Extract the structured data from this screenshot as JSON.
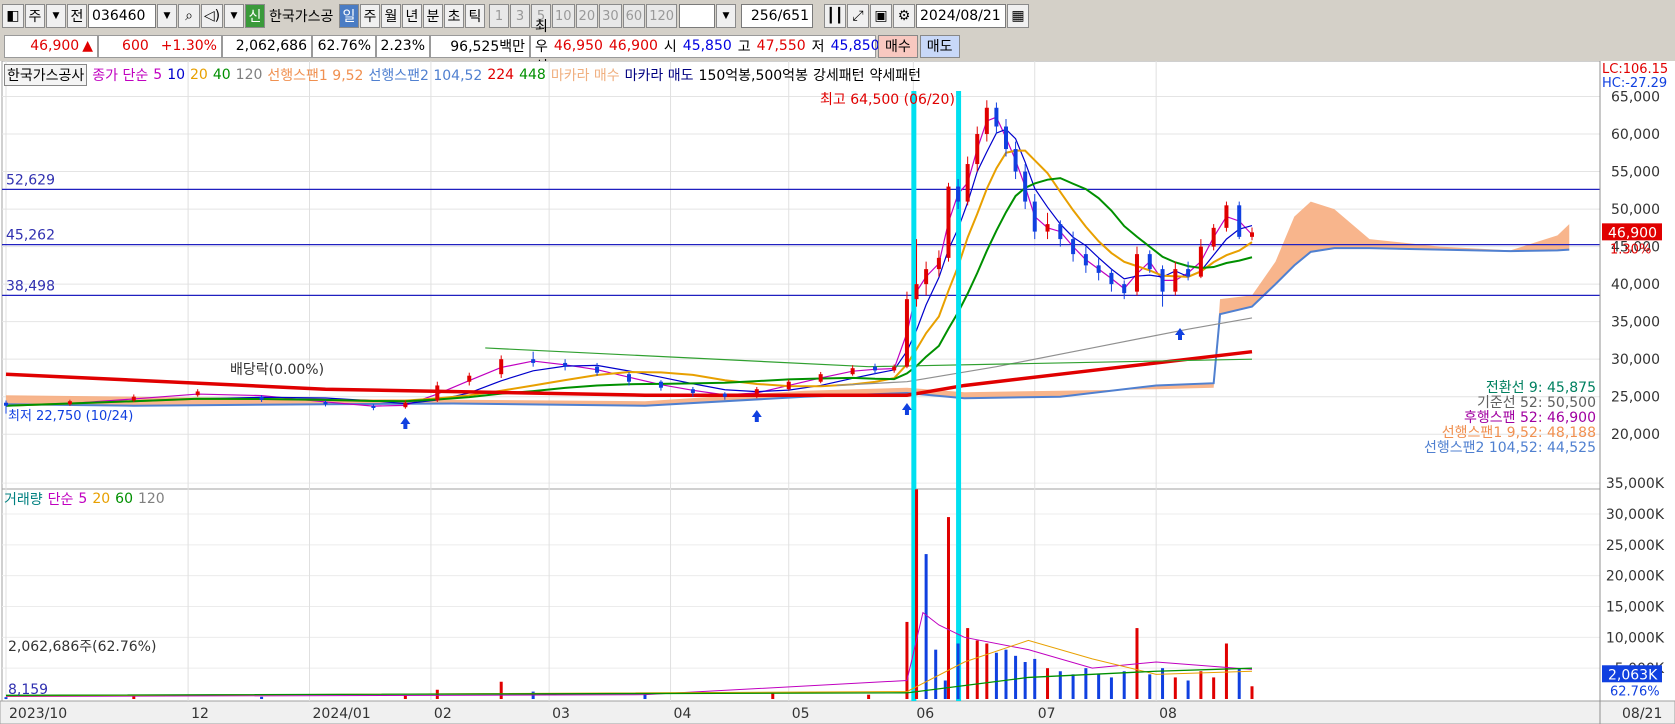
{
  "toolbar": {
    "period_btn": "주",
    "prev_btn": "전",
    "code": "036460",
    "new_btn": "신",
    "stock_name": "한국가스공",
    "period_tabs": [
      "일",
      "주",
      "월",
      "년",
      "분",
      "초",
      "틱"
    ],
    "active_tab": "일",
    "intervals": [
      "1",
      "3",
      "5",
      "10",
      "20",
      "30",
      "60",
      "120"
    ],
    "count": "256",
    "total": "/651",
    "date": "2024/08/21"
  },
  "quote": {
    "price": "46,900",
    "arrow": "▲",
    "change": "600",
    "change_pct": "+1.30%",
    "volume": "2,062,686",
    "vol_ratio": "62.76%",
    "turnover": "2.23%",
    "amount": "96,525백만",
    "best_label": "최우선",
    "ask": "46,950",
    "bid": "46,900",
    "open_label": "시",
    "open": "45,850",
    "high_label": "고",
    "high": "47,550",
    "low_label": "저",
    "low": "45,850",
    "buy_btn": "매수",
    "sell_btn": "매도"
  },
  "price_legend": [
    {
      "text": "한국가스공사",
      "color": "#000000",
      "boxed": true
    },
    {
      "text": "종가 단순",
      "color": "#c000c0"
    },
    {
      "text": "5",
      "color": "#c000c0"
    },
    {
      "text": "10",
      "color": "#0000cc"
    },
    {
      "text": "20",
      "color": "#e8a000"
    },
    {
      "text": "40",
      "color": "#009000"
    },
    {
      "text": "120",
      "color": "#808080"
    },
    {
      "text": "선행스팬1 9,52",
      "color": "#f09050"
    },
    {
      "text": "선행스팬2 104,52",
      "color": "#5080d0"
    },
    {
      "text": "224",
      "color": "#e00000"
    },
    {
      "text": "448",
      "color": "#009000"
    },
    {
      "text": "마카라 매수",
      "color": "#f0b080"
    },
    {
      "text": "마카라 매도",
      "color": "#000080"
    },
    {
      "text": "150억봉,500억봉",
      "color": "#000000"
    },
    {
      "text": "강세패턴",
      "color": "#000000"
    },
    {
      "text": "약세패턴",
      "color": "#000000"
    }
  ],
  "volume_legend": [
    {
      "text": "거래량",
      "color": "#008080"
    },
    {
      "text": "단순",
      "color": "#c000c0"
    },
    {
      "text": "5",
      "color": "#c000c0"
    },
    {
      "text": "20",
      "color": "#e8a000"
    },
    {
      "text": "60",
      "color": "#009000"
    },
    {
      "text": "120",
      "color": "#808080"
    }
  ],
  "volume_info": "2,062,686주(62.76%)",
  "colors": {
    "up": "#e00000",
    "down": "#1040e0",
    "cyan": "#00e0f0",
    "hline": "#2020c0"
  },
  "chart_data": {
    "type": "candlestick",
    "x_ticks": [
      "2023/10",
      "12",
      "2024/01",
      "02",
      "03",
      "04",
      "05",
      "06",
      "07",
      "08"
    ],
    "last_date_label": "08/21",
    "y_ticks": [
      "65,000",
      "60,000",
      "55,000",
      "50,000",
      "45,000",
      "40,000",
      "35,000",
      "30,000",
      "25,000",
      "20,000"
    ],
    "ylim": [
      17500,
      66000
    ],
    "h_lines": [
      {
        "value": 52629,
        "label": "52,629"
      },
      {
        "value": 45262,
        "label": "45,262"
      },
      {
        "value": 38498,
        "label": "38,498"
      }
    ],
    "current_price": "46,900",
    "current_pct": "1.30%",
    "lc": "LC:106.15",
    "hc": "HC:-27.29",
    "high_annot": "최고 64,500 (06/20)",
    "low_annot": "최저 22,750 (10/24)",
    "dividend_annot": "배당락(0.00%)",
    "ichimoku": [
      {
        "text": "전환선 9: 45,875",
        "color": "#008060"
      },
      {
        "text": "기준선 52: 50,500",
        "color": "#606060"
      },
      {
        "text": "후행스팬 52: 46,900",
        "color": "#a000a0"
      },
      {
        "text": "선행스팬1 9,52: 48,188",
        "color": "#f09050"
      },
      {
        "text": "선행스팬2 104,52: 44,525",
        "color": "#5080d0"
      }
    ],
    "price_series": [
      {
        "d": 0,
        "o": 24200,
        "c": 23800,
        "h": 24500,
        "l": 22750
      },
      {
        "d": 20,
        "o": 24000,
        "c": 24400,
        "h": 24600,
        "l": 23800
      },
      {
        "d": 40,
        "o": 24500,
        "c": 25000,
        "h": 25300,
        "l": 24300
      },
      {
        "d": 60,
        "o": 25200,
        "c": 25700,
        "h": 26000,
        "l": 25000
      },
      {
        "d": 80,
        "o": 25000,
        "c": 24600,
        "h": 25200,
        "l": 24300
      },
      {
        "d": 100,
        "o": 24300,
        "c": 24000,
        "h": 24500,
        "l": 23700
      },
      {
        "d": 115,
        "o": 23800,
        "c": 23500,
        "h": 24000,
        "l": 23200
      },
      {
        "d": 125,
        "o": 23600,
        "c": 24200,
        "h": 24500,
        "l": 23400
      },
      {
        "d": 135,
        "o": 24500,
        "c": 26500,
        "h": 27000,
        "l": 24300
      },
      {
        "d": 145,
        "o": 27000,
        "c": 27800,
        "h": 28200,
        "l": 26500
      },
      {
        "d": 155,
        "o": 28000,
        "c": 30000,
        "h": 30500,
        "l": 27500
      },
      {
        "d": 165,
        "o": 30000,
        "c": 29500,
        "h": 31000,
        "l": 29000
      },
      {
        "d": 175,
        "o": 29500,
        "c": 29000,
        "h": 30000,
        "l": 28500
      },
      {
        "d": 185,
        "o": 29000,
        "c": 28200,
        "h": 29500,
        "l": 27800
      },
      {
        "d": 195,
        "o": 28000,
        "c": 27000,
        "h": 28300,
        "l": 26500
      },
      {
        "d": 205,
        "o": 27000,
        "c": 26200,
        "h": 27200,
        "l": 25800
      },
      {
        "d": 215,
        "o": 26000,
        "c": 25500,
        "h": 26300,
        "l": 25000
      },
      {
        "d": 225,
        "o": 25400,
        "c": 25000,
        "h": 25600,
        "l": 24600
      },
      {
        "d": 235,
        "o": 25000,
        "c": 26000,
        "h": 26300,
        "l": 24800
      },
      {
        "d": 245,
        "o": 26000,
        "c": 27000,
        "h": 27300,
        "l": 25800
      },
      {
        "d": 255,
        "o": 27000,
        "c": 28000,
        "h": 28300,
        "l": 26800
      },
      {
        "d": 265,
        "o": 28000,
        "c": 28800,
        "h": 29200,
        "l": 27800
      },
      {
        "d": 272,
        "o": 29000,
        "c": 28500,
        "h": 29400,
        "l": 28000
      },
      {
        "d": 278,
        "o": 28500,
        "c": 29000,
        "h": 29300,
        "l": 28200
      },
      {
        "d": 282,
        "o": 29000,
        "c": 38000,
        "h": 39000,
        "l": 28800
      },
      {
        "d": 285,
        "o": 38000,
        "c": 40000,
        "h": 46000,
        "l": 37000
      },
      {
        "d": 288,
        "o": 40000,
        "c": 42000,
        "h": 43000,
        "l": 38500
      },
      {
        "d": 292,
        "o": 42000,
        "c": 43500,
        "h": 44500,
        "l": 41000
      },
      {
        "d": 295,
        "o": 43500,
        "c": 53000,
        "h": 53500,
        "l": 43000
      },
      {
        "d": 298,
        "o": 53000,
        "c": 51000,
        "h": 54000,
        "l": 50000
      },
      {
        "d": 301,
        "o": 51000,
        "c": 56000,
        "h": 57000,
        "l": 50500
      },
      {
        "d": 304,
        "o": 56000,
        "c": 60000,
        "h": 61000,
        "l": 55000
      },
      {
        "d": 307,
        "o": 60000,
        "c": 63500,
        "h": 64500,
        "l": 59000
      },
      {
        "d": 310,
        "o": 63500,
        "c": 61000,
        "h": 64200,
        "l": 60000
      },
      {
        "d": 313,
        "o": 61000,
        "c": 58000,
        "h": 62000,
        "l": 57000
      },
      {
        "d": 316,
        "o": 58000,
        "c": 55000,
        "h": 59000,
        "l": 54000
      },
      {
        "d": 319,
        "o": 55000,
        "c": 51000,
        "h": 56000,
        "l": 50000
      },
      {
        "d": 322,
        "o": 51000,
        "c": 47000,
        "h": 52000,
        "l": 46000
      },
      {
        "d": 326,
        "o": 47000,
        "c": 48000,
        "h": 49500,
        "l": 46000
      },
      {
        "d": 330,
        "o": 48000,
        "c": 46000,
        "h": 48500,
        "l": 45000
      },
      {
        "d": 334,
        "o": 46000,
        "c": 44000,
        "h": 47000,
        "l": 43000
      },
      {
        "d": 338,
        "o": 44000,
        "c": 42500,
        "h": 45000,
        "l": 41500
      },
      {
        "d": 342,
        "o": 42500,
        "c": 41500,
        "h": 43500,
        "l": 40500
      },
      {
        "d": 346,
        "o": 41500,
        "c": 40000,
        "h": 42000,
        "l": 39000
      },
      {
        "d": 350,
        "o": 40000,
        "c": 38800,
        "h": 40500,
        "l": 38000
      },
      {
        "d": 354,
        "o": 39000,
        "c": 44000,
        "h": 45000,
        "l": 38500
      },
      {
        "d": 358,
        "o": 44000,
        "c": 42000,
        "h": 44500,
        "l": 41500
      },
      {
        "d": 362,
        "o": 42000,
        "c": 39000,
        "h": 42500,
        "l": 37000
      },
      {
        "d": 366,
        "o": 39000,
        "c": 42000,
        "h": 43000,
        "l": 38500
      },
      {
        "d": 370,
        "o": 42000,
        "c": 41000,
        "h": 43000,
        "l": 40500
      },
      {
        "d": 374,
        "o": 41000,
        "c": 45000,
        "h": 46000,
        "l": 40800
      },
      {
        "d": 378,
        "o": 45000,
        "c": 47500,
        "h": 48000,
        "l": 44500
      },
      {
        "d": 382,
        "o": 47500,
        "c": 50500,
        "h": 51000,
        "l": 47000
      },
      {
        "d": 386,
        "o": 50500,
        "c": 46300,
        "h": 51000,
        "l": 46000
      },
      {
        "d": 390,
        "o": 46300,
        "c": 46900,
        "h": 47550,
        "l": 45850
      }
    ],
    "volume_series": [
      {
        "d": 0,
        "v": 300,
        "up": false
      },
      {
        "d": 40,
        "v": 400,
        "up": true
      },
      {
        "d": 80,
        "v": 350,
        "up": false
      },
      {
        "d": 125,
        "v": 600,
        "up": true
      },
      {
        "d": 135,
        "v": 1500,
        "up": true
      },
      {
        "d": 155,
        "v": 2800,
        "up": true
      },
      {
        "d": 165,
        "v": 1200,
        "up": false
      },
      {
        "d": 200,
        "v": 800,
        "up": false
      },
      {
        "d": 240,
        "v": 900,
        "up": true
      },
      {
        "d": 270,
        "v": 700,
        "up": true
      },
      {
        "d": 282,
        "v": 12500,
        "up": true
      },
      {
        "d": 285,
        "v": 34000,
        "up": true
      },
      {
        "d": 288,
        "v": 23500,
        "up": false
      },
      {
        "d": 291,
        "v": 8000,
        "up": false
      },
      {
        "d": 294,
        "v": 3000,
        "up": false
      },
      {
        "d": 295,
        "v": 29500,
        "up": true
      },
      {
        "d": 298,
        "v": 9000,
        "up": false
      },
      {
        "d": 301,
        "v": 11500,
        "up": true
      },
      {
        "d": 304,
        "v": 9500,
        "up": true
      },
      {
        "d": 307,
        "v": 9000,
        "up": true
      },
      {
        "d": 310,
        "v": 7500,
        "up": false
      },
      {
        "d": 313,
        "v": 8000,
        "up": false
      },
      {
        "d": 316,
        "v": 7000,
        "up": false
      },
      {
        "d": 319,
        "v": 6000,
        "up": false
      },
      {
        "d": 322,
        "v": 6500,
        "up": false
      },
      {
        "d": 326,
        "v": 5000,
        "up": true
      },
      {
        "d": 330,
        "v": 4500,
        "up": false
      },
      {
        "d": 334,
        "v": 4000,
        "up": false
      },
      {
        "d": 338,
        "v": 5000,
        "up": false
      },
      {
        "d": 342,
        "v": 4000,
        "up": false
      },
      {
        "d": 346,
        "v": 3500,
        "up": false
      },
      {
        "d": 350,
        "v": 4500,
        "up": false
      },
      {
        "d": 354,
        "v": 11500,
        "up": true
      },
      {
        "d": 358,
        "v": 4000,
        "up": false
      },
      {
        "d": 362,
        "v": 5000,
        "up": false
      },
      {
        "d": 366,
        "v": 3500,
        "up": true
      },
      {
        "d": 370,
        "v": 3000,
        "up": false
      },
      {
        "d": 374,
        "v": 4500,
        "up": true
      },
      {
        "d": 378,
        "v": 3500,
        "up": true
      },
      {
        "d": 382,
        "v": 9000,
        "up": true
      },
      {
        "d": 386,
        "v": 5000,
        "up": false
      },
      {
        "d": 390,
        "v": 2063,
        "up": true
      }
    ],
    "vol_y_ticks": [
      "35,000K",
      "30,000K",
      "25,000K",
      "20,000K",
      "15,000K",
      "10,000K",
      "5,000K"
    ],
    "vol_ylim": [
      0,
      36000
    ],
    "vol_current": "2,063K",
    "vol_current_pct": "62.76%",
    "vol_min_label": "8,159"
  }
}
